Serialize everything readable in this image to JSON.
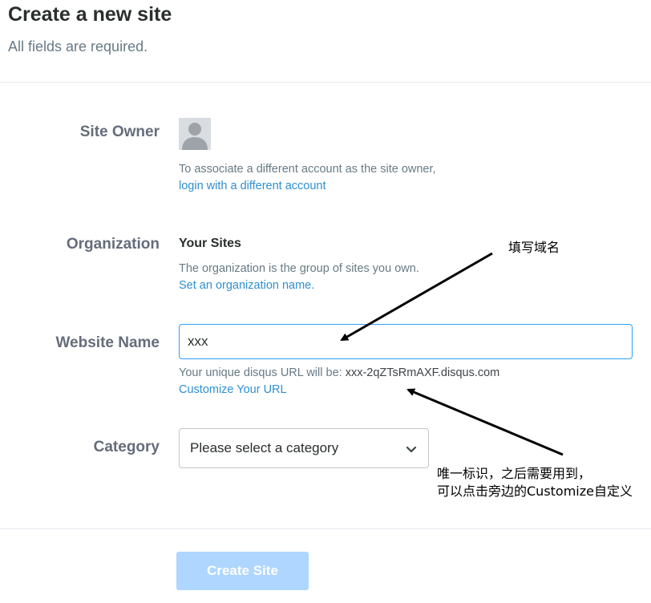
{
  "header": {
    "title": "Create a new site",
    "subtitle": "All fields are required."
  },
  "site_owner": {
    "label": "Site Owner",
    "avatar_icon": "user-avatar-icon",
    "help_text": "To associate a different account as the site owner,",
    "link_text": "login with a different account"
  },
  "organization": {
    "label": "Organization",
    "value": "Your Sites",
    "help_text": "The organization is the group of sites you own.",
    "link_text": "Set an organization name."
  },
  "website_name": {
    "label": "Website Name",
    "value": "xxx",
    "url_prefix": "Your unique disqus URL will be: ",
    "url_value": "xxx-2qZTsRmAXF.disqus.com",
    "customize_link": "Customize Your URL"
  },
  "category": {
    "label": "Category",
    "selected": "Please select a category",
    "icon": "chevron-down-icon"
  },
  "actions": {
    "create_label": "Create Site"
  },
  "annotations": {
    "domain_note": "填写域名",
    "url_note_line1": "唯一标识，之后需要用到，",
    "url_note_line2": "可以点击旁边的Customize自定义"
  },
  "colors": {
    "accent": "#2e9fff",
    "link": "#2f8fd0",
    "button_disabled": "#aed6ff",
    "label_gray": "#656c7a"
  }
}
